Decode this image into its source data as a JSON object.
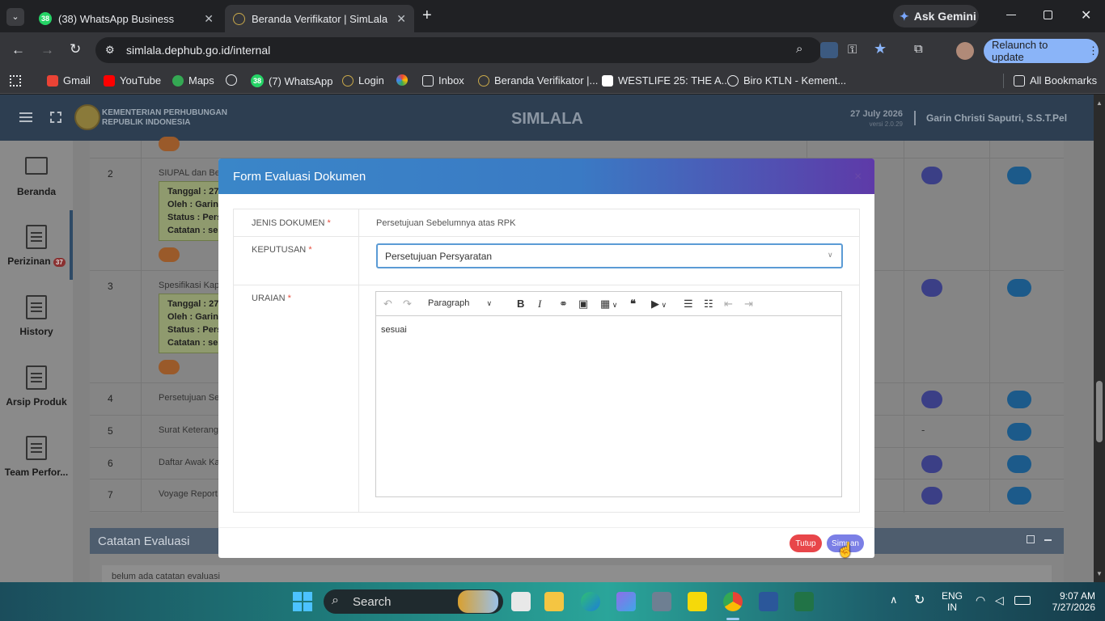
{
  "browser": {
    "tabs": [
      {
        "title": "(38) WhatsApp Business",
        "badge": "38"
      },
      {
        "title": "Beranda Verifikator | SimLala"
      }
    ],
    "url": "simlala.dephub.go.id/internal",
    "ask_gemini": "Ask Gemini",
    "relaunch": "Relaunch to update",
    "bookmarks": [
      "Gmail",
      "YouTube",
      "Maps",
      "(7) WhatsApp",
      "Login",
      "Inbox",
      "Beranda Verifikator |...",
      "WESTLIFE 25: THE A...",
      "Biro KTLN - Kement..."
    ],
    "bookmark_badge": "38",
    "all_bookmarks": "All Bookmarks"
  },
  "app": {
    "ministry_line1": "KEMENTERIAN PERHUBUNGAN",
    "ministry_line2": "REPUBLIK INDONESIA",
    "title": "SIMLALA",
    "date": "27 July 2026",
    "version": "versi 2.0.29",
    "user": "Garin Christi Saputri, S.S.T.Pel"
  },
  "sidebar": {
    "items": [
      {
        "label": "Beranda"
      },
      {
        "label": "Perizinan",
        "badge": "37"
      },
      {
        "label": "History"
      },
      {
        "label": "Arsip Produk"
      },
      {
        "label": "Team Perfor..."
      }
    ]
  },
  "table": {
    "rows": [
      {
        "no": "2",
        "doc": "SIUPAL dan Beri",
        "tanggal": "Tanggal : 27",
        "oleh": "Oleh : Garin C",
        "status": "Status : Pers",
        "catatan": "Catatan : ses"
      },
      {
        "no": "3",
        "doc": "Spesifikasi Kapa",
        "tanggal": "Tanggal : 27",
        "oleh": "Oleh : Garin C",
        "status": "Status : Pers",
        "catatan": "Catatan : ses"
      },
      {
        "no": "4",
        "doc": "Persetujuan Seb"
      },
      {
        "no": "5",
        "doc": "Surat Keterang",
        "download": "-"
      },
      {
        "no": "6",
        "doc": "Daftar Awak Kap"
      },
      {
        "no": "7",
        "doc": "Voyage Report ("
      }
    ]
  },
  "catatan": {
    "title": "Catatan Evaluasi",
    "body": "belum ada catatan evaluasi"
  },
  "modal": {
    "title": "Form Evaluasi Dokumen",
    "close": "×",
    "jenis_label": "JENIS DOKUMEN",
    "jenis_value": "Persetujuan Sebelumnya atas RPK",
    "keputusan_label": "KEPUTUSAN",
    "keputusan_value": "Persetujuan Persyaratan",
    "uraian_label": "URAIAN",
    "required_mark": "*",
    "paragraph_style": "Paragraph",
    "editor_text": "sesuai",
    "tutup": "Tutup",
    "simpan": "Simpan"
  },
  "taskbar": {
    "search": "Search",
    "lang1": "ENG",
    "lang2": "IN",
    "time": "9:07 AM",
    "date": "7/27/2026"
  }
}
